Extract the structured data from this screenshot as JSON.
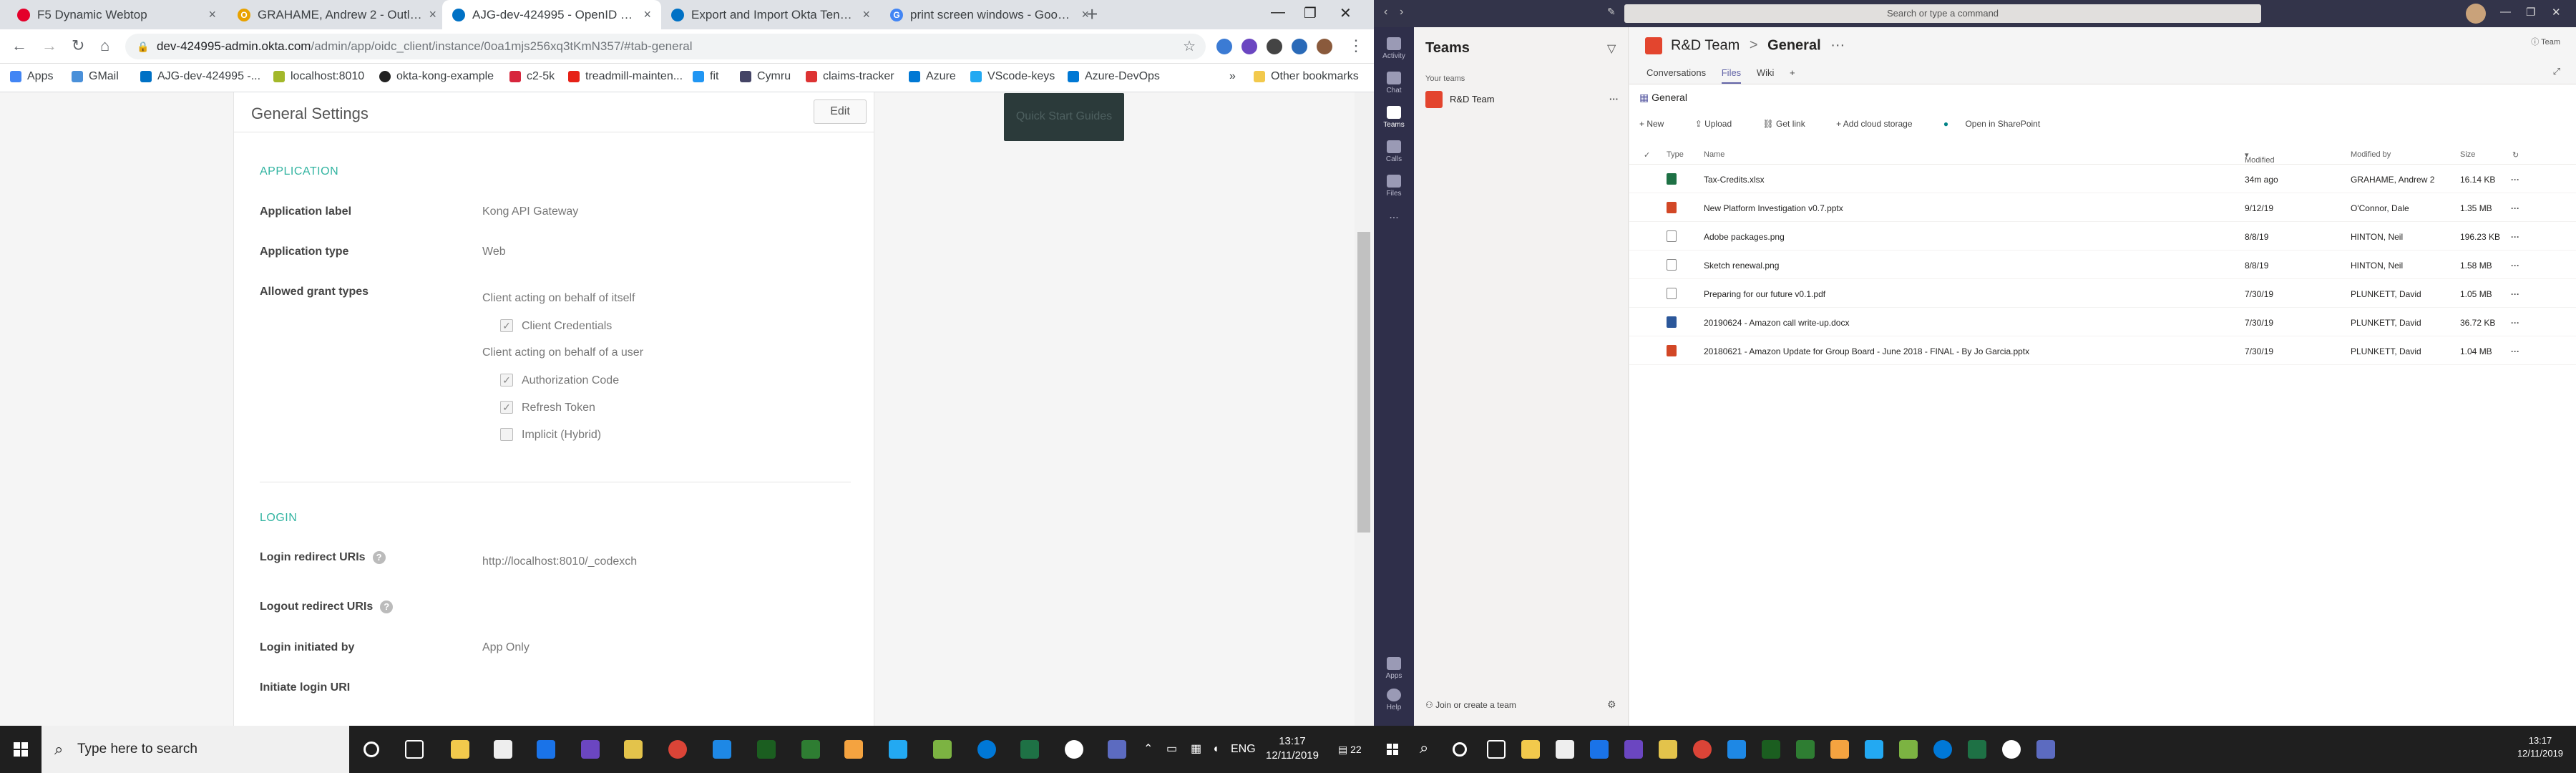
{
  "browser": {
    "tabs": [
      {
        "label": "F5 Dynamic Webtop",
        "icon": "f5-icon",
        "color": "#e4002b",
        "active": false
      },
      {
        "label": "GRAHAME, Andrew 2 - Outlook",
        "icon": "outlook-icon",
        "color": "#e8a200",
        "active": false
      },
      {
        "label": "AJG-dev-424995 - OpenID Conn",
        "icon": "okta-icon",
        "color": "#0071c5",
        "active": true
      },
      {
        "label": "Export and Import Okta Tenant C",
        "icon": "okta-icon",
        "color": "#0071c5",
        "active": false
      },
      {
        "label": "print screen windows - Google S",
        "icon": "google-icon",
        "color": "#4285f4",
        "active": false
      }
    ],
    "url_host": "dev-424995-admin.okta.com",
    "url_path": "/admin/app/oidc_client/instance/0oa1mjs256xq3tKmN357/#tab-general",
    "bookmarks": [
      {
        "label": "Apps",
        "color": "#4285f4"
      },
      {
        "label": "GMail",
        "color": "#4a90d9"
      },
      {
        "label": "AJG-dev-424995 -...",
        "color": "#0071c5"
      },
      {
        "label": "localhost:8010",
        "color": "#a3b82a"
      },
      {
        "label": "okta-kong-example",
        "color": "#222222"
      },
      {
        "label": "c2-5k",
        "color": "#d7263d"
      },
      {
        "label": "treadmill-mainten...",
        "color": "#e62117"
      },
      {
        "label": "fit",
        "color": "#2196f3"
      },
      {
        "label": "Cymru",
        "color": "#444466"
      },
      {
        "label": "claims-tracker",
        "color": "#dd3333"
      },
      {
        "label": "Azure",
        "color": "#0078d4"
      },
      {
        "label": "VScode-keys",
        "color": "#23a9f2"
      },
      {
        "label": "Azure-DevOps",
        "color": "#0078d4"
      }
    ],
    "other_bookmarks": "Other bookmarks",
    "overflow": "»"
  },
  "okta": {
    "panel_title": "General Settings",
    "edit_label": "Edit",
    "quick_start": "Quick Start Guides",
    "application_section": "APPLICATION",
    "app_label_label": "Application label",
    "app_label_value": "Kong API Gateway",
    "app_type_label": "Application type",
    "app_type_value": "Web",
    "grant_label": "Allowed grant types",
    "grant_group_itself": "Client acting on behalf of itself",
    "grant_client_credentials": "Client Credentials",
    "grant_group_user": "Client acting on behalf of a user",
    "grant_auth_code": "Authorization Code",
    "grant_refresh_token": "Refresh Token",
    "grant_implicit": "Implicit (Hybrid)",
    "login_section": "LOGIN",
    "redirect_label": "Login redirect URIs",
    "redirect_value": "http://localhost:8010/_codexch",
    "logout_label": "Logout redirect URIs",
    "initiated_label": "Login initiated by",
    "initiated_value": "App Only",
    "initiate_uri_label": "Initiate login URI"
  },
  "taskbar_left": {
    "search_placeholder": "Type here to search",
    "lang": "ENG",
    "time": "13:17",
    "date": "12/11/2019",
    "notif_count": "22"
  },
  "teams": {
    "search_placeholder": "Search or type a command",
    "top_right": "Team",
    "rail": [
      "Activity",
      "Chat",
      "Teams",
      "Calls",
      "Files",
      "...",
      "Apps",
      "Help"
    ],
    "list_title": "Teams",
    "your_teams": "Your teams",
    "team_name": "R&D Team",
    "join_label": "Join or create a team",
    "crumb_team": "R&D Team",
    "crumb_sep": ">",
    "crumb_channel": "General",
    "tabs": [
      "Conversations",
      "Files",
      "Wiki"
    ],
    "folder": "General",
    "commands": [
      "New",
      "Upload",
      "Get link",
      "Add cloud storage",
      "Open in SharePoint"
    ],
    "columns": {
      "type": "Type",
      "name": "Name",
      "modified": "Modified",
      "modified_by": "Modified by",
      "size": "Size"
    },
    "files": [
      {
        "name": "Tax-Credits.xlsx",
        "modified": "34m ago",
        "by": "GRAHAME, Andrew 2",
        "size": "16.14 KB",
        "kind": "xlsx"
      },
      {
        "name": "New Platform Investigation v0.7.pptx",
        "modified": "9/12/19",
        "by": "O'Connor, Dale",
        "size": "1.35 MB",
        "kind": "pptx"
      },
      {
        "name": "Adobe packages.png",
        "modified": "8/8/19",
        "by": "HINTON, Neil",
        "size": "196.23 KB",
        "kind": "png"
      },
      {
        "name": "Sketch renewal.png",
        "modified": "8/8/19",
        "by": "HINTON, Neil",
        "size": "1.58 MB",
        "kind": "png"
      },
      {
        "name": "Preparing for our future v0.1.pdf",
        "modified": "7/30/19",
        "by": "PLUNKETT, David",
        "size": "1.05 MB",
        "kind": "pdf"
      },
      {
        "name": "20190624 - Amazon call write-up.docx",
        "modified": "7/30/19",
        "by": "PLUNKETT, David",
        "size": "36.72 KB",
        "kind": "docx"
      },
      {
        "name": "20180621 - Amazon Update for Group Board - June 2018 - FINAL - By Jo Garcia.pptx",
        "modified": "7/30/19",
        "by": "PLUNKETT, David",
        "size": "1.04 MB",
        "kind": "pptx"
      }
    ]
  },
  "taskbar_right": {
    "time": "13:17",
    "date": "12/11/2019"
  }
}
